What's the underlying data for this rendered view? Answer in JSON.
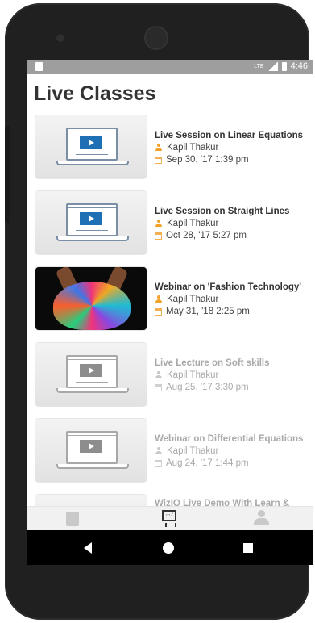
{
  "status_bar": {
    "network": "LTE",
    "time": "4:46"
  },
  "page_title": "Live Classes",
  "items": [
    {
      "title": "Live Session on Linear Equations",
      "teacher": "Kapil Thakur",
      "date": "Sep 30, '17 1:39 pm",
      "thumbnail": "laptop-video",
      "faded": false
    },
    {
      "title": "Live Session on Straight Lines",
      "teacher": "Kapil Thakur",
      "date": "Oct 28, '17 5:27 pm",
      "thumbnail": "laptop-video",
      "faded": false
    },
    {
      "title": "Webinar on 'Fashion Technology'",
      "teacher": "Kapil Thakur",
      "date": "May 31, '18 2:25 pm",
      "thumbnail": "photo",
      "faded": false
    },
    {
      "title": "Live Lecture on Soft skills",
      "teacher": "Kapil Thakur",
      "date": "Aug 25, '17 3:30 pm",
      "thumbnail": "laptop-video",
      "faded": true
    },
    {
      "title": "Webinar on Differential Equations",
      "teacher": "Kapil Thakur",
      "date": "Aug 24, '17 1:44 pm",
      "thumbnail": "laptop-video",
      "faded": true
    },
    {
      "title": "WizIQ Live Demo With Learn &",
      "teacher": "",
      "date": "",
      "thumbnail": "laptop-video",
      "faded": true
    }
  ],
  "tabs": [
    {
      "name": "courses",
      "icon": "book-icon"
    },
    {
      "name": "live-classes",
      "icon": "classroom-icon",
      "active": true
    },
    {
      "name": "profile",
      "icon": "user-icon"
    }
  ],
  "colors": {
    "accent": "#f3a32a",
    "video_blue": "#1f6fb5",
    "status_bar": "#9e9e9e"
  }
}
